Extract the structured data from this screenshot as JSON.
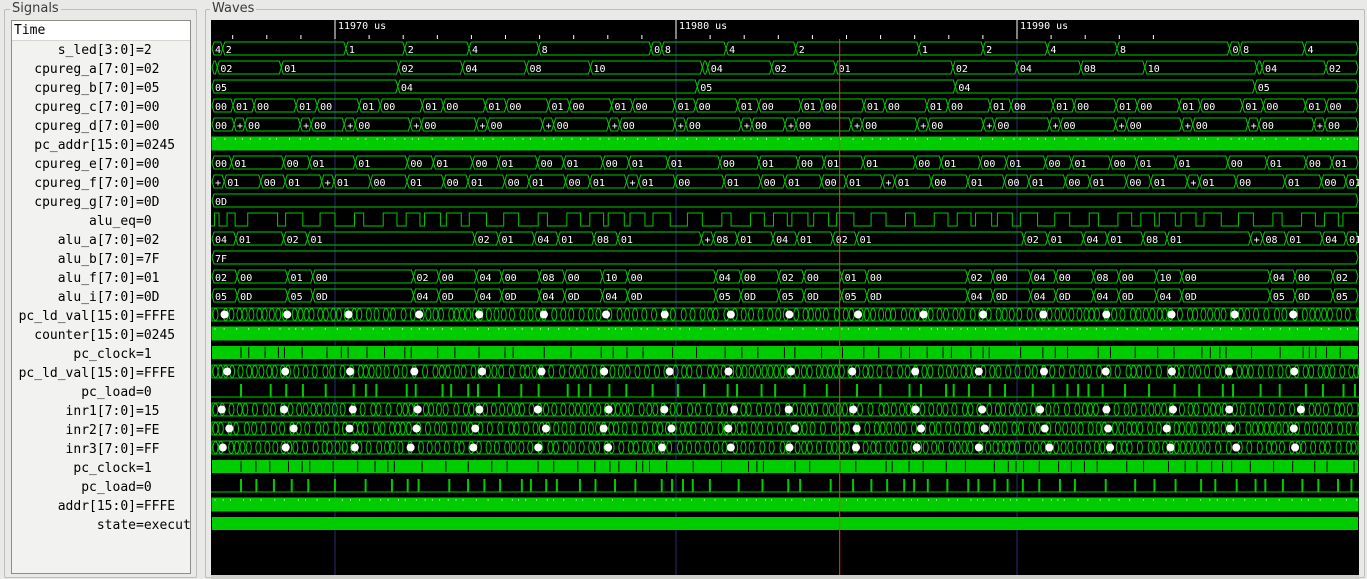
{
  "panels": {
    "signals_title": "Signals",
    "waves_title": "Waves"
  },
  "time_header": "Time",
  "time_marks": [
    {
      "label": "11970 us",
      "t": 11970
    },
    {
      "label": "11980 us",
      "t": 11980
    },
    {
      "label": "11990 us",
      "t": 11990
    }
  ],
  "cursor_time_us": 11984.8,
  "colors": {
    "wave": "#00cc00",
    "background": "#000000",
    "cursor": "#ff3030",
    "text": "#ffffff",
    "marker": "#2a2a7a"
  },
  "signals": [
    {
      "name": "s_led[3:0]",
      "value": "=2",
      "kind": "bus",
      "segs": [
        [
          "4",
          1
        ],
        [
          "2",
          11.5
        ],
        [
          "1",
          5.5
        ],
        [
          "2",
          6
        ],
        [
          "4",
          6.5
        ],
        [
          "8",
          10.5
        ],
        [
          "0",
          1
        ],
        [
          "8",
          6
        ],
        [
          "4",
          6.5
        ],
        [
          "2",
          11.5
        ],
        [
          "1",
          6
        ],
        [
          "2",
          6
        ],
        [
          "4",
          6.5
        ],
        [
          "8",
          10.5
        ],
        [
          "0",
          1
        ],
        [
          "8",
          6
        ],
        [
          "4",
          5
        ]
      ]
    },
    {
      "name": "cpureg_a[7:0]",
      "value": "=02",
      "kind": "bus",
      "segs": [
        [
          "+",
          0.5
        ],
        [
          "02",
          6
        ],
        [
          "01",
          11
        ],
        [
          "02",
          6
        ],
        [
          "04",
          6
        ],
        [
          "08",
          6
        ],
        [
          "10",
          10.5
        ],
        [
          "+",
          0.5
        ],
        [
          "04",
          6
        ],
        [
          "02",
          6
        ],
        [
          "01",
          11
        ],
        [
          "02",
          6
        ],
        [
          "04",
          6
        ],
        [
          "08",
          6
        ],
        [
          "10",
          10.5
        ],
        [
          "+",
          0.5
        ],
        [
          "04",
          6
        ],
        [
          "02",
          3
        ]
      ]
    },
    {
      "name": "cpureg_b[7:0]",
      "value": "=05",
      "kind": "bus",
      "segs": [
        [
          "05",
          18
        ],
        [
          "04",
          29
        ],
        [
          "05",
          25
        ],
        [
          "04",
          29
        ],
        [
          "05",
          10
        ]
      ]
    },
    {
      "name": "cpureg_c[7:0]",
      "value": "=00",
      "kind": "bus",
      "segs": [
        [
          "00",
          2
        ],
        [
          "01",
          2
        ],
        [
          "00",
          4
        ],
        [
          "01",
          2
        ],
        [
          "00",
          4
        ],
        [
          "01",
          2
        ],
        [
          "00",
          4
        ],
        [
          "01",
          2
        ],
        [
          "00",
          4
        ],
        [
          "01",
          2
        ],
        [
          "00",
          4
        ],
        [
          "01",
          2
        ],
        [
          "00",
          4
        ],
        [
          "01",
          2
        ],
        [
          "00",
          4
        ],
        [
          "01",
          2
        ],
        [
          "00",
          4
        ],
        [
          "01",
          2
        ],
        [
          "00",
          4
        ],
        [
          "01",
          2
        ],
        [
          "00",
          4
        ],
        [
          "01",
          2
        ],
        [
          "00",
          4
        ],
        [
          "01",
          2
        ],
        [
          "00",
          4
        ],
        [
          "01",
          2
        ],
        [
          "00",
          4
        ],
        [
          "01",
          2
        ],
        [
          "00",
          4
        ],
        [
          "01",
          2
        ],
        [
          "00",
          4
        ],
        [
          "01",
          2
        ],
        [
          "00",
          4
        ],
        [
          "01",
          2
        ],
        [
          "00",
          4
        ],
        [
          "01",
          2
        ],
        [
          "00",
          3
        ]
      ]
    },
    {
      "name": "cpureg_d[7:0]",
      "value": "=00",
      "kind": "bus",
      "segs": [
        [
          "00",
          2
        ],
        [
          "+",
          1
        ],
        [
          "00",
          5
        ],
        [
          "+",
          1
        ],
        [
          "00",
          3
        ],
        [
          "+",
          1
        ],
        [
          "00",
          5
        ],
        [
          "+",
          1
        ],
        [
          "00",
          5
        ],
        [
          "+",
          1
        ],
        [
          "00",
          5
        ],
        [
          "+",
          1
        ],
        [
          "00",
          5
        ],
        [
          "+",
          1
        ],
        [
          "00",
          5
        ],
        [
          "+",
          1
        ],
        [
          "00",
          5
        ],
        [
          "+",
          1
        ],
        [
          "00",
          3
        ],
        [
          "+",
          1
        ],
        [
          "00",
          5
        ],
        [
          "+",
          1
        ],
        [
          "00",
          5
        ],
        [
          "+",
          1
        ],
        [
          "00",
          5
        ],
        [
          "+",
          1
        ],
        [
          "00",
          5
        ],
        [
          "+",
          1
        ],
        [
          "00",
          5
        ],
        [
          "+",
          1
        ],
        [
          "00",
          5
        ],
        [
          "+",
          1
        ],
        [
          "00",
          5
        ],
        [
          "+",
          1
        ],
        [
          "00",
          5
        ],
        [
          "+",
          1
        ],
        [
          "00",
          3
        ]
      ]
    },
    {
      "name": "pc_addr[15:0]",
      "value": "=0245",
      "kind": "dense"
    },
    {
      "name": "cpureg_e[7:0]",
      "value": "=00",
      "kind": "bus",
      "segs": [
        [
          "00",
          1.5
        ],
        [
          "01",
          4
        ],
        [
          "00",
          2
        ],
        [
          "01",
          3.5
        ],
        [
          "01",
          4
        ],
        [
          "00",
          2
        ],
        [
          "01",
          3
        ],
        [
          "00",
          2
        ],
        [
          "01",
          3
        ],
        [
          "00",
          2
        ],
        [
          "01",
          3
        ],
        [
          "00",
          2
        ],
        [
          "01",
          3
        ],
        [
          "01",
          4
        ],
        [
          "00",
          3
        ],
        [
          "01",
          3
        ],
        [
          "00",
          2
        ],
        [
          "01",
          3
        ],
        [
          "01",
          4
        ],
        [
          "00",
          2
        ],
        [
          "01",
          3
        ],
        [
          "00",
          2
        ],
        [
          "01",
          3
        ],
        [
          "00",
          2
        ],
        [
          "01",
          3
        ],
        [
          "00",
          2
        ],
        [
          "01",
          3
        ],
        [
          "01",
          4
        ],
        [
          "00",
          3
        ],
        [
          "01",
          3
        ],
        [
          "00",
          2
        ],
        [
          "01",
          2
        ]
      ]
    },
    {
      "name": "cpureg_f[7:0]",
      "value": "=00",
      "kind": "bus",
      "segs": [
        [
          "+",
          1
        ],
        [
          "01",
          3
        ],
        [
          "00",
          2
        ],
        [
          "01",
          3
        ],
        [
          "+",
          1
        ],
        [
          "01",
          3
        ],
        [
          "00",
          3
        ],
        [
          "01",
          3
        ],
        [
          "00",
          2
        ],
        [
          "01",
          3
        ],
        [
          "00",
          2
        ],
        [
          "01",
          3
        ],
        [
          "00",
          2
        ],
        [
          "01",
          3
        ],
        [
          "+",
          1
        ],
        [
          "01",
          3
        ],
        [
          "00",
          4
        ],
        [
          "01",
          3
        ],
        [
          "00",
          2
        ],
        [
          "01",
          3
        ],
        [
          "00",
          2
        ],
        [
          "01",
          3
        ],
        [
          "+",
          1
        ],
        [
          "01",
          3
        ],
        [
          "00",
          3
        ],
        [
          "01",
          3
        ],
        [
          "00",
          2
        ],
        [
          "01",
          3
        ],
        [
          "00",
          2
        ],
        [
          "01",
          3
        ],
        [
          "00",
          2
        ],
        [
          "01",
          3
        ],
        [
          "+",
          1
        ],
        [
          "01",
          3
        ],
        [
          "00",
          4
        ],
        [
          "01",
          3
        ],
        [
          "00",
          2
        ],
        [
          "01",
          1
        ]
      ]
    },
    {
      "name": "cpureg_g[7:0]",
      "value": "=0D",
      "kind": "bus",
      "segs": [
        [
          "0D",
          100
        ]
      ]
    },
    {
      "name": "alu_eq",
      "value": "=0",
      "kind": "bit",
      "edges": [
        0.3,
        0.7,
        1.4,
        2.1,
        3.2,
        5.8,
        6.5,
        8.0,
        9.5,
        10.8,
        12.5,
        13.3,
        15.0,
        16.2,
        17.0,
        18.2,
        18.6,
        20.0,
        20.5,
        21.8,
        22.5,
        24.0,
        25.5,
        26.8,
        28.5,
        29.3,
        31.0,
        32.2,
        33.0,
        34.2,
        34.6,
        36.0,
        36.5,
        37.8,
        38.5,
        40.0,
        41.5,
        42.8,
        44.5,
        45.3,
        47.0,
        48.2,
        49.0,
        50.2,
        50.6,
        52.0,
        52.5,
        53.8,
        54.5,
        56.0,
        57.5,
        58.8,
        60.5,
        61.3,
        63.0,
        64.2,
        65.0,
        66.2,
        66.6,
        68.0,
        68.5,
        69.8,
        70.5,
        72.0,
        73.5,
        74.8,
        76.5,
        77.3,
        79.0,
        80.2,
        81.0,
        82.2,
        82.6,
        84.0,
        84.5,
        85.8,
        86.5,
        88.0,
        89.5,
        90.8,
        92.5,
        93.3,
        95.0,
        96.2,
        97.0,
        98.2,
        98.6
      ]
    },
    {
      "name": "alu_a[7:0]",
      "value": "=02",
      "kind": "bus",
      "segs": [
        [
          "04",
          2
        ],
        [
          "01",
          4
        ],
        [
          "02",
          2
        ],
        [
          "01",
          14
        ],
        [
          "02",
          2
        ],
        [
          "01",
          3
        ],
        [
          "04",
          2
        ],
        [
          "01",
          3
        ],
        [
          "08",
          2
        ],
        [
          "01",
          7
        ],
        [
          "+",
          1
        ],
        [
          "08",
          2
        ],
        [
          "01",
          3
        ],
        [
          "04",
          2
        ],
        [
          "01",
          3
        ],
        [
          "02",
          2
        ],
        [
          "01",
          14
        ],
        [
          "02",
          2
        ],
        [
          "01",
          3
        ],
        [
          "04",
          2
        ],
        [
          "01",
          3
        ],
        [
          "08",
          2
        ],
        [
          "01",
          7
        ],
        [
          "+",
          1
        ],
        [
          "08",
          2
        ],
        [
          "01",
          3
        ],
        [
          "04",
          2
        ],
        [
          "01",
          1
        ]
      ]
    },
    {
      "name": "alu_b[7:0]",
      "value": "=7F",
      "kind": "bus",
      "segs": [
        [
          "7F",
          100
        ]
      ]
    },
    {
      "name": "alu_f[7:0]",
      "value": "=01",
      "kind": "bus",
      "segs": [
        [
          "02",
          2
        ],
        [
          "00",
          4
        ],
        [
          "01",
          2
        ],
        [
          "00",
          8
        ],
        [
          "02",
          2
        ],
        [
          "00",
          3
        ],
        [
          "04",
          2
        ],
        [
          "00",
          3
        ],
        [
          "08",
          2
        ],
        [
          "00",
          3
        ],
        [
          "10",
          2
        ],
        [
          "00",
          7
        ],
        [
          "04",
          2
        ],
        [
          "00",
          3
        ],
        [
          "02",
          2
        ],
        [
          "00",
          3
        ],
        [
          "01",
          2
        ],
        [
          "00",
          8
        ],
        [
          "02",
          2
        ],
        [
          "00",
          3
        ],
        [
          "04",
          2
        ],
        [
          "00",
          3
        ],
        [
          "08",
          2
        ],
        [
          "00",
          3
        ],
        [
          "10",
          2
        ],
        [
          "00",
          7
        ],
        [
          "04",
          2
        ],
        [
          "00",
          3
        ],
        [
          "02",
          2
        ]
      ]
    },
    {
      "name": "alu_i[7:0]",
      "value": "=0D",
      "kind": "bus",
      "segs": [
        [
          "05",
          2
        ],
        [
          "0D",
          4
        ],
        [
          "05",
          2
        ],
        [
          "0D",
          8
        ],
        [
          "04",
          2
        ],
        [
          "0D",
          3
        ],
        [
          "04",
          2
        ],
        [
          "0D",
          3
        ],
        [
          "04",
          2
        ],
        [
          "0D",
          3
        ],
        [
          "04",
          2
        ],
        [
          "0D",
          7
        ],
        [
          "05",
          2
        ],
        [
          "0D",
          3
        ],
        [
          "05",
          2
        ],
        [
          "0D",
          3
        ],
        [
          "05",
          2
        ],
        [
          "0D",
          8
        ],
        [
          "04",
          2
        ],
        [
          "0D",
          3
        ],
        [
          "04",
          2
        ],
        [
          "0D",
          3
        ],
        [
          "04",
          2
        ],
        [
          "0D",
          3
        ],
        [
          "04",
          2
        ],
        [
          "0D",
          7
        ],
        [
          "05",
          2
        ],
        [
          "0D",
          3
        ],
        [
          "05",
          2
        ]
      ]
    },
    {
      "name": "pc_ld_val[15:0]",
      "value": "=FFFE",
      "kind": "dense"
    },
    {
      "name": "counter[15:0]",
      "value": "=0245",
      "kind": "dense"
    },
    {
      "name": "pc_clock",
      "value": "=1",
      "kind": "clock"
    },
    {
      "name": "pc_ld_val[15:0]",
      "value": "=FFFE",
      "kind": "dense"
    },
    {
      "name": "pc_load",
      "value": "=0",
      "kind": "pulse"
    },
    {
      "name": "inr1[7:0]",
      "value": "=15",
      "kind": "dense"
    },
    {
      "name": "inr2[7:0]",
      "value": "=FE",
      "kind": "dense"
    },
    {
      "name": "inr3[7:0]",
      "value": "=FF",
      "kind": "dense"
    },
    {
      "name": "pc_clock",
      "value": "=1",
      "kind": "clock"
    },
    {
      "name": "pc_load",
      "value": "=0",
      "kind": "pulse"
    },
    {
      "name": "addr[15:0]",
      "value": "=FFFE",
      "kind": "dense"
    },
    {
      "name": "state",
      "value": "=execut",
      "kind": "solid"
    }
  ]
}
